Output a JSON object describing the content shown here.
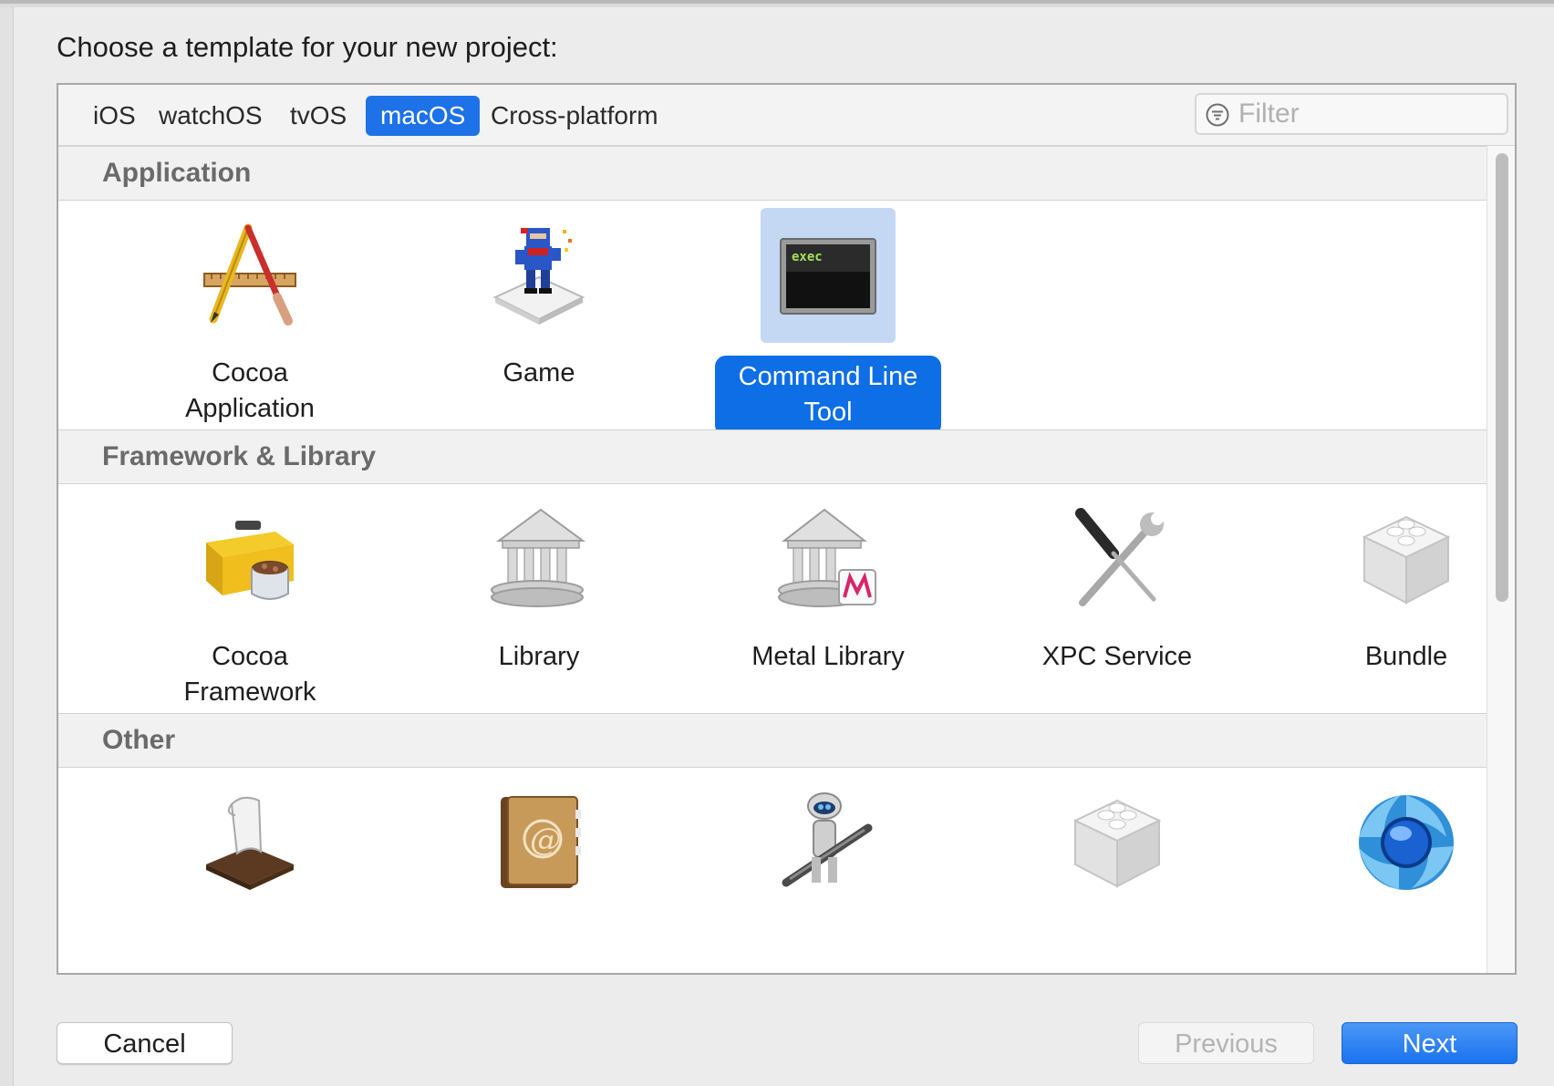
{
  "dialog": {
    "prompt": "Choose a template for your new project:"
  },
  "tabs": [
    {
      "label": "iOS",
      "active": false
    },
    {
      "label": "watchOS",
      "active": false
    },
    {
      "label": "tvOS",
      "active": false
    },
    {
      "label": "macOS",
      "active": true
    },
    {
      "label": "Cross-platform",
      "active": false
    }
  ],
  "filter": {
    "placeholder": "Filter",
    "value": "",
    "icon": "filter-icon"
  },
  "sections": [
    {
      "title": "Application",
      "items": [
        {
          "label": "Cocoa\nApplication",
          "icon": "cocoa-application-icon",
          "selected": false
        },
        {
          "label": "Game",
          "icon": "game-icon",
          "selected": false
        },
        {
          "label": "Command Line\nTool",
          "icon": "command-line-tool-icon",
          "icon_text": "exec",
          "selected": true
        }
      ]
    },
    {
      "title": "Framework & Library",
      "items": [
        {
          "label": "Cocoa\nFramework",
          "icon": "cocoa-framework-icon",
          "selected": false
        },
        {
          "label": "Library",
          "icon": "library-icon",
          "selected": false
        },
        {
          "label": "Metal Library",
          "icon": "metal-library-icon",
          "selected": false
        },
        {
          "label": "XPC Service",
          "icon": "xpc-service-icon",
          "selected": false
        },
        {
          "label": "Bundle",
          "icon": "bundle-icon",
          "selected": false
        }
      ]
    },
    {
      "title": "Other",
      "items": [
        {
          "label": "",
          "icon": "script-icon",
          "selected": false
        },
        {
          "label": "",
          "icon": "address-book-icon",
          "icon_text": "@",
          "selected": false
        },
        {
          "label": "",
          "icon": "automator-icon",
          "selected": false
        },
        {
          "label": "",
          "icon": "bundle-icon",
          "selected": false
        },
        {
          "label": "",
          "icon": "quartz-icon",
          "selected": false
        }
      ]
    }
  ],
  "buttons": {
    "cancel": "Cancel",
    "previous": "Previous",
    "next": "Next"
  },
  "colors": {
    "accent": "#1e72e8",
    "selection_label": "#0d6ee6",
    "selection_icon_bg": "#c4d8f4",
    "section_header_text": "#6a6a6a"
  }
}
